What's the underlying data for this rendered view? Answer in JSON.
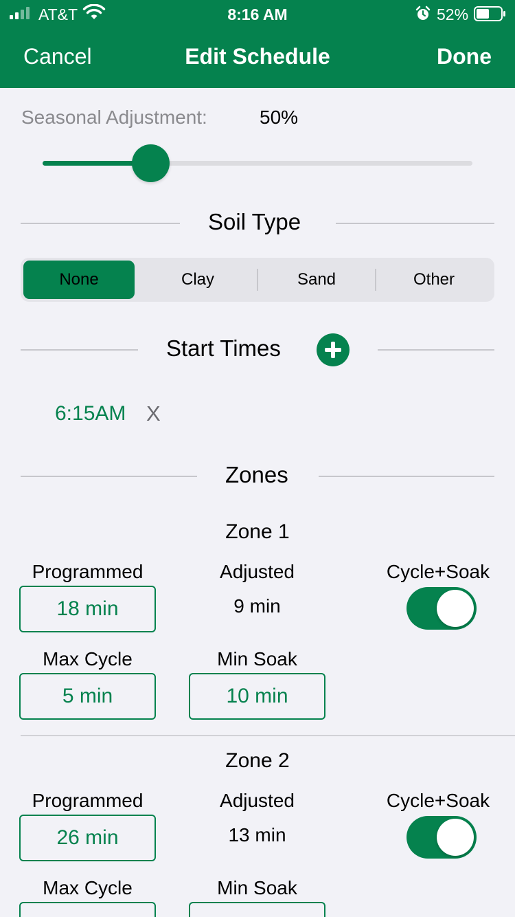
{
  "status_bar": {
    "carrier": "AT&T",
    "time": "8:16 AM",
    "battery_percent": "52%",
    "icons": [
      "signal-icon",
      "wifi-icon",
      "alarm-icon",
      "battery-icon"
    ]
  },
  "nav": {
    "cancel_label": "Cancel",
    "title": "Edit Schedule",
    "done_label": "Done"
  },
  "seasonal": {
    "label": "Seasonal Adjustment:",
    "value_text": "50%",
    "slider_value": 0.25
  },
  "soil_type": {
    "heading": "Soil Type",
    "options": [
      "None",
      "Clay",
      "Sand",
      "Other"
    ],
    "selected": "None"
  },
  "start_times": {
    "heading": "Start Times",
    "add_icon": "plus-circle-icon",
    "items": [
      {
        "time": "6:15AM",
        "remove_label": "X"
      }
    ]
  },
  "zones": {
    "heading": "Zones",
    "items": [
      {
        "name": "Zone 1",
        "programmed_label": "Programmed",
        "programmed_value": "18 min",
        "adjusted_label": "Adjusted",
        "adjusted_value": "9 min",
        "cycle_soak_label": "Cycle+Soak",
        "cycle_soak_on": true,
        "max_cycle_label": "Max Cycle",
        "max_cycle_value": "5 min",
        "min_soak_label": "Min Soak",
        "min_soak_value": "10 min"
      },
      {
        "name": "Zone 2",
        "programmed_label": "Programmed",
        "programmed_value": "26 min",
        "adjusted_label": "Adjusted",
        "adjusted_value": "13 min",
        "cycle_soak_label": "Cycle+Soak",
        "cycle_soak_on": true,
        "max_cycle_label": "Max Cycle",
        "max_cycle_value": "",
        "min_soak_label": "Min Soak",
        "min_soak_value": ""
      }
    ]
  },
  "colors": {
    "accent": "#05824e",
    "background": "#f2f2f7"
  }
}
